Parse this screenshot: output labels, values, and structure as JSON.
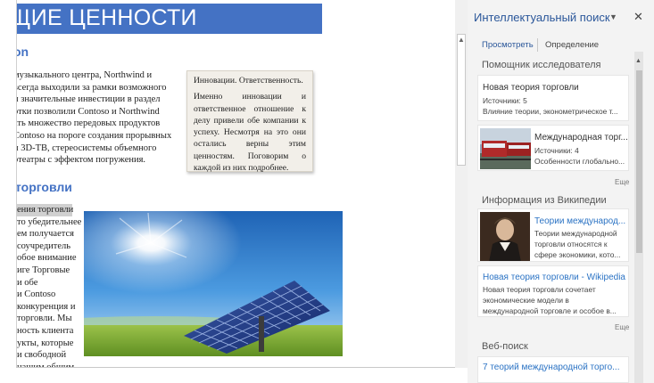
{
  "document": {
    "title": "ЩИЕ ЦЕННОСТИ",
    "heading1": "on",
    "paragraph1_lines": [
      "музыкального центра, Northwind и",
      "всегда выходили за рамки возможного",
      "и значительные инвестиции в раздел",
      "отки позволили Contoso и Northwind",
      "ать множество передовых продуктов",
      "Contoso на пороге создания прорывных",
      "и 3D-ТВ, стерео­системы объемного",
      "отеатры с эффектом погружения."
    ],
    "heading2": "торговли",
    "paragraph2_lines": [
      "ения торговли",
      "то убедительнее",
      "ем получается",
      "соучредитель",
      "обое внимание",
      "иге Торговые",
      "и    обе",
      "и    Contoso",
      "конкуренция и",
      "торговли. Мы",
      "ность клиента",
      "укты, которые",
      "и свободной",
      "нашим общим"
    ],
    "sidebar_note": {
      "title": "Инновации. Ответственность.",
      "body": "Именно инновации и ответственное отношение к делу привели обе компании к успеху. Несмотря на это они остались верны этим ценностям. Поговорим о каждой из них подробнее."
    }
  },
  "pane": {
    "title": "Интеллектуальный поиск",
    "dropdown_icon": "chevron-down-icon",
    "close_icon": "close-icon",
    "tabs": [
      "Просмотреть",
      "Определение"
    ],
    "sections": {
      "research": {
        "label": "Помощник исследователя",
        "cards": [
          {
            "title": "Новая теория торговли",
            "lines": [
              "Источники: 5",
              "Влияние теории, эконометрическое т..."
            ]
          },
          {
            "title": "Международная торг...",
            "lines": [
              "Источники: 4",
              "Особенности глобально..."
            ]
          }
        ],
        "more": "Еще"
      },
      "wikipedia": {
        "label": "Информация из Википедии",
        "cards": [
          {
            "title": "Теории международ...",
            "lines": [
              "Теории международной",
              "торговли относятся к",
              "сфере экономики, кото..."
            ]
          },
          {
            "title": "Новая теория торговли - Wikipedia",
            "lines": [
              "Новая теория торговли сочетает",
              "экономические модели в",
              "международной торговле и особое в..."
            ]
          }
        ],
        "more": "Еще"
      },
      "web": {
        "label": "Веб-поиск",
        "first_result": "7 теорий международной торго..."
      }
    }
  }
}
